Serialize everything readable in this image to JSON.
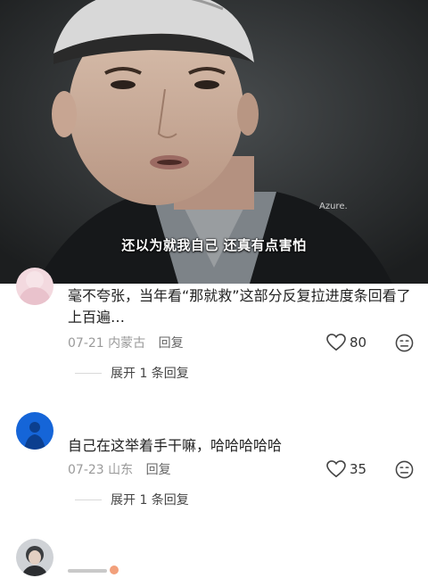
{
  "video": {
    "watermark": "Azure.",
    "subtitle": "还以为就我自己  还真有点害怕"
  },
  "comments": [
    {
      "text": "毫不夸张，当年看“那就救”这部分反复拉进度条回看了上百遍…",
      "date": "07-21",
      "location": "内蒙古",
      "reply_label": "回复",
      "likes": "80",
      "expand_label": "展开 1 条回复"
    },
    {
      "text": "自己在这举着手干嘛，哈哈哈哈哈",
      "date": "07-23",
      "location": "山东",
      "reply_label": "回复",
      "likes": "35",
      "expand_label": "展开 1 条回复"
    }
  ],
  "icons": {
    "like": "heart-outline-icon",
    "dislike": "frown-face-icon"
  }
}
